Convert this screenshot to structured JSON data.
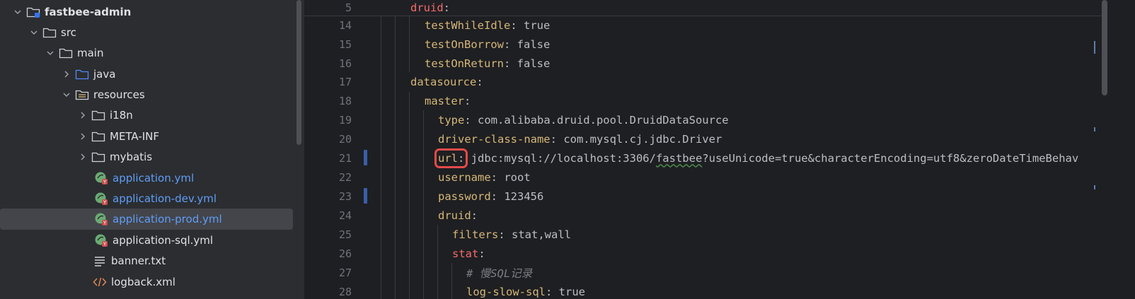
{
  "tree": {
    "items": [
      {
        "label": "fastbee-admin",
        "type": "module",
        "expanded": true
      },
      {
        "label": "src",
        "type": "folder",
        "expanded": true
      },
      {
        "label": "main",
        "type": "folder",
        "expanded": true
      },
      {
        "label": "java",
        "type": "source-folder",
        "expanded": false
      },
      {
        "label": "resources",
        "type": "resources-folder",
        "expanded": true
      },
      {
        "label": "i18n",
        "type": "folder",
        "expanded": false
      },
      {
        "label": "META-INF",
        "type": "folder",
        "expanded": false
      },
      {
        "label": "mybatis",
        "type": "folder",
        "expanded": false
      },
      {
        "label": "application.yml",
        "type": "spring-yml"
      },
      {
        "label": "application-dev.yml",
        "type": "spring-yml"
      },
      {
        "label": "application-prod.yml",
        "type": "spring-yml",
        "selected": true
      },
      {
        "label": "application-sql.yml",
        "type": "spring-yml"
      },
      {
        "label": "banner.txt",
        "type": "text-file"
      },
      {
        "label": "logback.xml",
        "type": "xml-file"
      }
    ]
  },
  "editor": {
    "sticky": {
      "line": "5",
      "key": "druid",
      "colon": ":"
    },
    "lines": [
      {
        "n": "14",
        "key": "testWhileIdle",
        "sep": ": ",
        "value": "true"
      },
      {
        "n": "15",
        "key": "testOnBorrow",
        "sep": ": ",
        "value": "false"
      },
      {
        "n": "16",
        "key": "testOnReturn",
        "sep": ": ",
        "value": "false"
      },
      {
        "n": "17",
        "key": "datasource",
        "sep": ":",
        "value": ""
      },
      {
        "n": "18",
        "key": "master",
        "sep": ":",
        "value": ""
      },
      {
        "n": "19",
        "key": "type",
        "sep": ": ",
        "value": "com.alibaba.druid.pool.DruidDataSource"
      },
      {
        "n": "20",
        "key": "driver-class-name",
        "sep": ": ",
        "value": "com.mysql.cj.jdbc.Driver"
      },
      {
        "n": "21",
        "key": "url",
        "sep": ":",
        "value_a": " jdbc:mysql://localhost:3306/",
        "value_b": "fastbee",
        "value_c": "?useUnicode=true&characterEncoding=utf8&zeroDateTimeBehav"
      },
      {
        "n": "22",
        "key": "username",
        "sep": ": ",
        "value": "root"
      },
      {
        "n": "23",
        "key": "password",
        "sep": ": ",
        "value": "123456"
      },
      {
        "n": "24",
        "key": "druid",
        "sep": ":",
        "value": ""
      },
      {
        "n": "25",
        "key": "filters",
        "sep": ": ",
        "value": "stat,wall"
      },
      {
        "n": "26",
        "key": "stat",
        "sep": ":",
        "value": ""
      },
      {
        "n": "27",
        "comment": "# 慢SQL记录"
      },
      {
        "n": "28",
        "key": "log-slow-sql",
        "sep": ": ",
        "value": "true"
      }
    ]
  },
  "colors": {
    "sidebar_bg": "#2b2d30",
    "editor_bg": "#1e1f22",
    "yaml_key": "#d5b778",
    "yaml_key_red": "#f56a6a",
    "yml_file_label": "#5f9df7",
    "highlight_box": "#e34b4b"
  }
}
